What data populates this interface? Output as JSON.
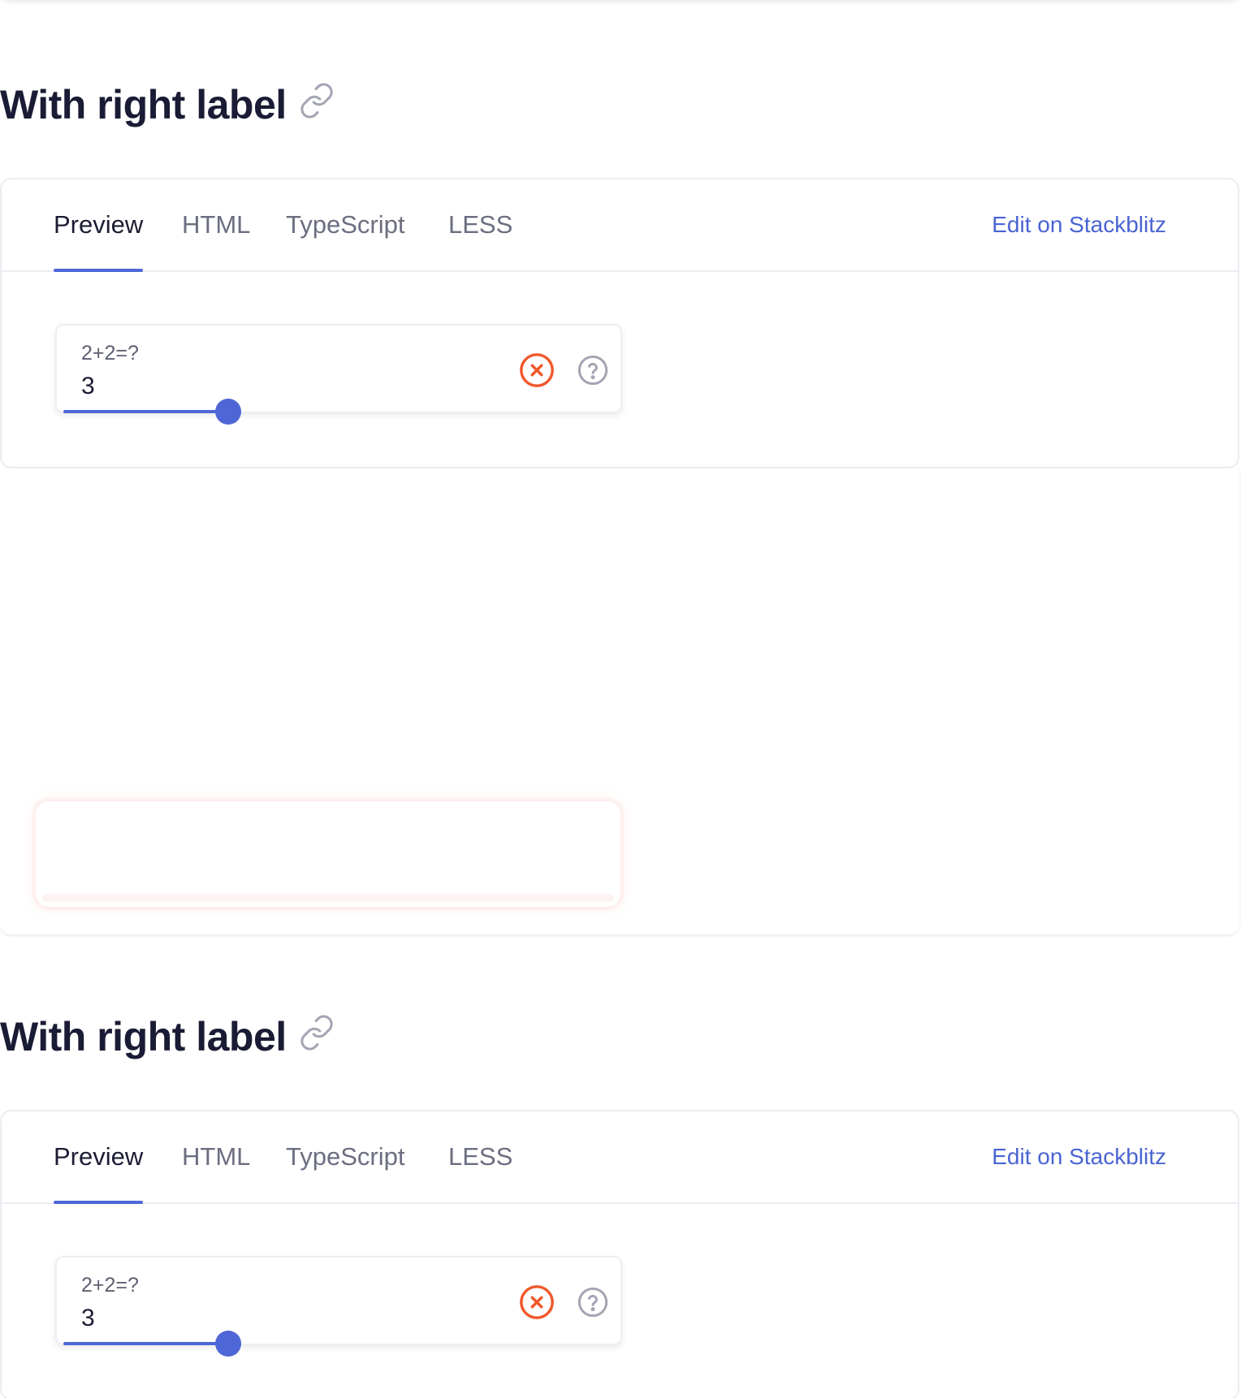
{
  "sections": [
    {
      "title": "With right label",
      "tabs": [
        {
          "label": "Preview",
          "active": true
        },
        {
          "label": "HTML",
          "active": false
        },
        {
          "label": "TypeScript",
          "active": false
        },
        {
          "label": "LESS",
          "active": false
        }
      ],
      "stackblitz_label": "Edit on Stackblitz",
      "field": {
        "label": "2+2=?",
        "value": "3",
        "slider_fraction": 0.3
      }
    },
    {
      "title": "With right label",
      "tabs": [
        {
          "label": "Preview",
          "active": true
        },
        {
          "label": "HTML",
          "active": false
        },
        {
          "label": "TypeScript",
          "active": false
        },
        {
          "label": "LESS",
          "active": false
        }
      ],
      "stackblitz_label": "Edit on Stackblitz",
      "field": {
        "label": "2+2=?",
        "value": "3",
        "slider_fraction": 0.3
      }
    }
  ],
  "colors": {
    "accent": "#4f67d6",
    "error": "#f0582b",
    "muted_icon": "#a3a5b3",
    "title": "#1a1c35"
  },
  "icons": {
    "title_link": "link-icon",
    "clear": "close-circle-icon",
    "help": "help-circle-icon"
  }
}
